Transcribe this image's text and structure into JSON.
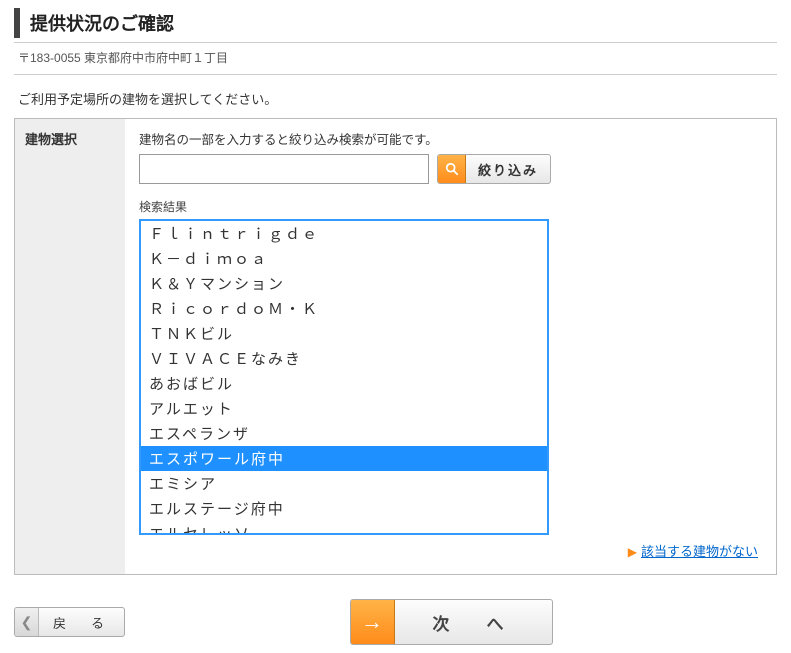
{
  "title": "提供状況のご確認",
  "address": "〒183-0055 東京都府中市府中町１丁目",
  "instruction": "ご利用予定場所の建物を選択してください。",
  "panel_label": "建物選択",
  "hint": "建物名の一部を入力すると絞り込み検索が可能です。",
  "search": {
    "value": "",
    "placeholder": ""
  },
  "filter_label": "絞り込み",
  "results_label": "検索結果",
  "results": [
    "Ｆｌｉｎｔｒｉｇｄｅ",
    "Ｋ－ｄｉｍｏａ",
    "Ｋ＆Ｙマンション",
    "ＲｉｃｏｒｄｏＭ・Ｋ",
    "ＴＮＫビル",
    "ＶＩＶＡＣＥなみき",
    "あおばビル",
    "アルエット",
    "エスペランザ",
    "エスポワール府中",
    "エミシア",
    "エルステージ府中",
    "エルセレッソ"
  ],
  "selected_index": 9,
  "not_found_link": "該当する建物がない",
  "back_label": "戻　る",
  "next_label": "次　へ"
}
